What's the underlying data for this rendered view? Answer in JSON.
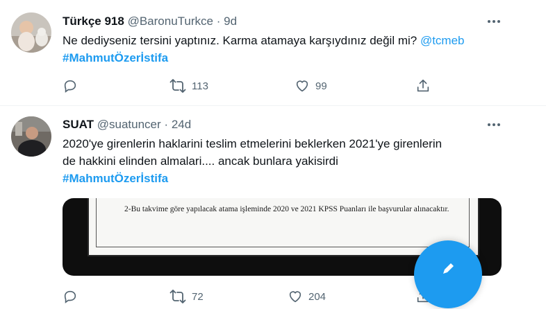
{
  "tweets": [
    {
      "name": "Türkçe 918",
      "handle": "@BaronuTurkce",
      "dot": "·",
      "time": "9d",
      "text_line1": "Ne dediyseniz tersini yaptınız. Karma atamaya karşıydınız değil mi? ",
      "mention": "@tcmeb",
      "hashtag": "#MahmutÖzerİstifa",
      "retweets": "113",
      "likes": "99"
    },
    {
      "name": "SUAT",
      "handle": "@suatuncer",
      "dot": "·",
      "time": "24d",
      "text_line1": "2020'ye girenlerin haklarini teslim etmelerini beklerken 2021'ye girenlerin",
      "text_line2": "de hakkini elinden almalari.... ancak bunlara yakisirdi",
      "hashtag": "#MahmutÖzerİstifa",
      "media_text": "2-Bu takvime göre yapılacak atama işleminde 2020 ve 2021 KPSS Puanları ile başvurular alınacaktır.",
      "retweets": "72",
      "likes": "204"
    }
  ],
  "colors": {
    "accent": "#1d9bf0",
    "secondary_text": "#536471",
    "primary_text": "#0f1419"
  },
  "icons": {
    "reply": "reply-icon",
    "retweet": "retweet-icon",
    "like": "heart-icon",
    "share": "share-icon",
    "more": "more-icon",
    "compose": "compose-icon"
  }
}
